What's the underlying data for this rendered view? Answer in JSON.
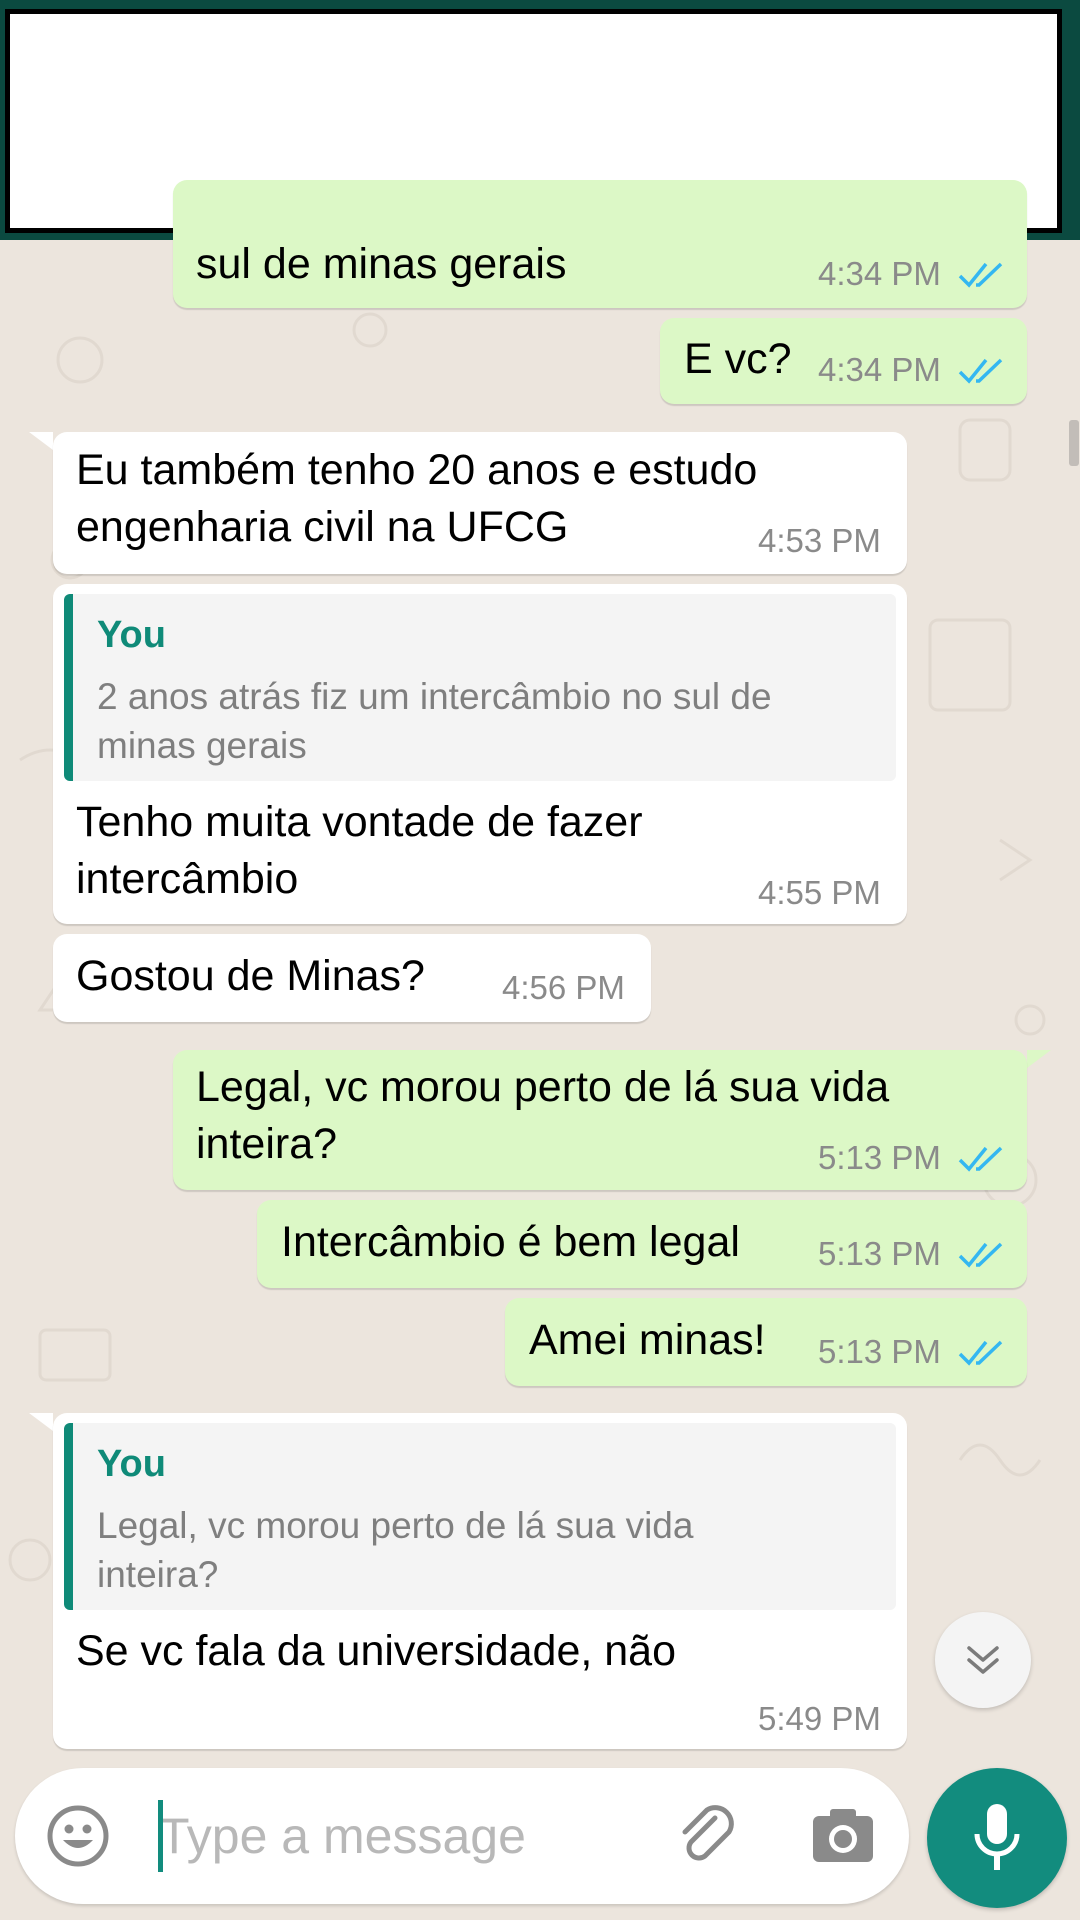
{
  "messages": [
    {
      "direction": "out",
      "text": "sul de minas gerais",
      "time": "4:34 PM",
      "status": "read"
    },
    {
      "direction": "out",
      "text": "E vc?",
      "time": "4:34 PM",
      "status": "read"
    },
    {
      "direction": "in",
      "lines": [
        "Eu também tenho 20 anos e estudo",
        "engenharia civil na UFCG"
      ],
      "time": "4:53 PM"
    },
    {
      "direction": "in",
      "quote": {
        "author": "You",
        "lines": [
          "2 anos atrás fiz um intercâmbio no sul de",
          "minas gerais"
        ]
      },
      "lines": [
        "Tenho muita vontade de fazer",
        "intercâmbio"
      ],
      "time": "4:55 PM"
    },
    {
      "direction": "in",
      "text": "Gostou de Minas?",
      "time": "4:56 PM"
    },
    {
      "direction": "out",
      "lines": [
        "Legal, vc morou perto de lá sua vida",
        "inteira?"
      ],
      "time": "5:13 PM",
      "status": "read"
    },
    {
      "direction": "out",
      "text": "Intercâmbio é bem legal",
      "time": "5:13 PM",
      "status": "read"
    },
    {
      "direction": "out",
      "text": "Amei minas!",
      "time": "5:13 PM",
      "status": "read"
    },
    {
      "direction": "in",
      "quote": {
        "author": "You",
        "lines": [
          "Legal, vc morou perto de lá sua vida",
          "inteira?"
        ]
      },
      "text": "Se vc fala da universidade, não",
      "time": "5:49 PM"
    }
  ],
  "composer": {
    "placeholder": "Type a message",
    "emoji_icon": "emoji-icon",
    "attach_icon": "paperclip-icon",
    "camera_icon": "camera-icon",
    "mic_icon": "microphone-icon"
  },
  "scroll_button_icon": "double-chevron-down-icon",
  "colors": {
    "incoming_bubble": "#ffffff",
    "outgoing_bubble": "#dcf8c6",
    "accent": "#128c7e",
    "read_ticks": "#34b7f1",
    "background": "#ece5dd"
  }
}
